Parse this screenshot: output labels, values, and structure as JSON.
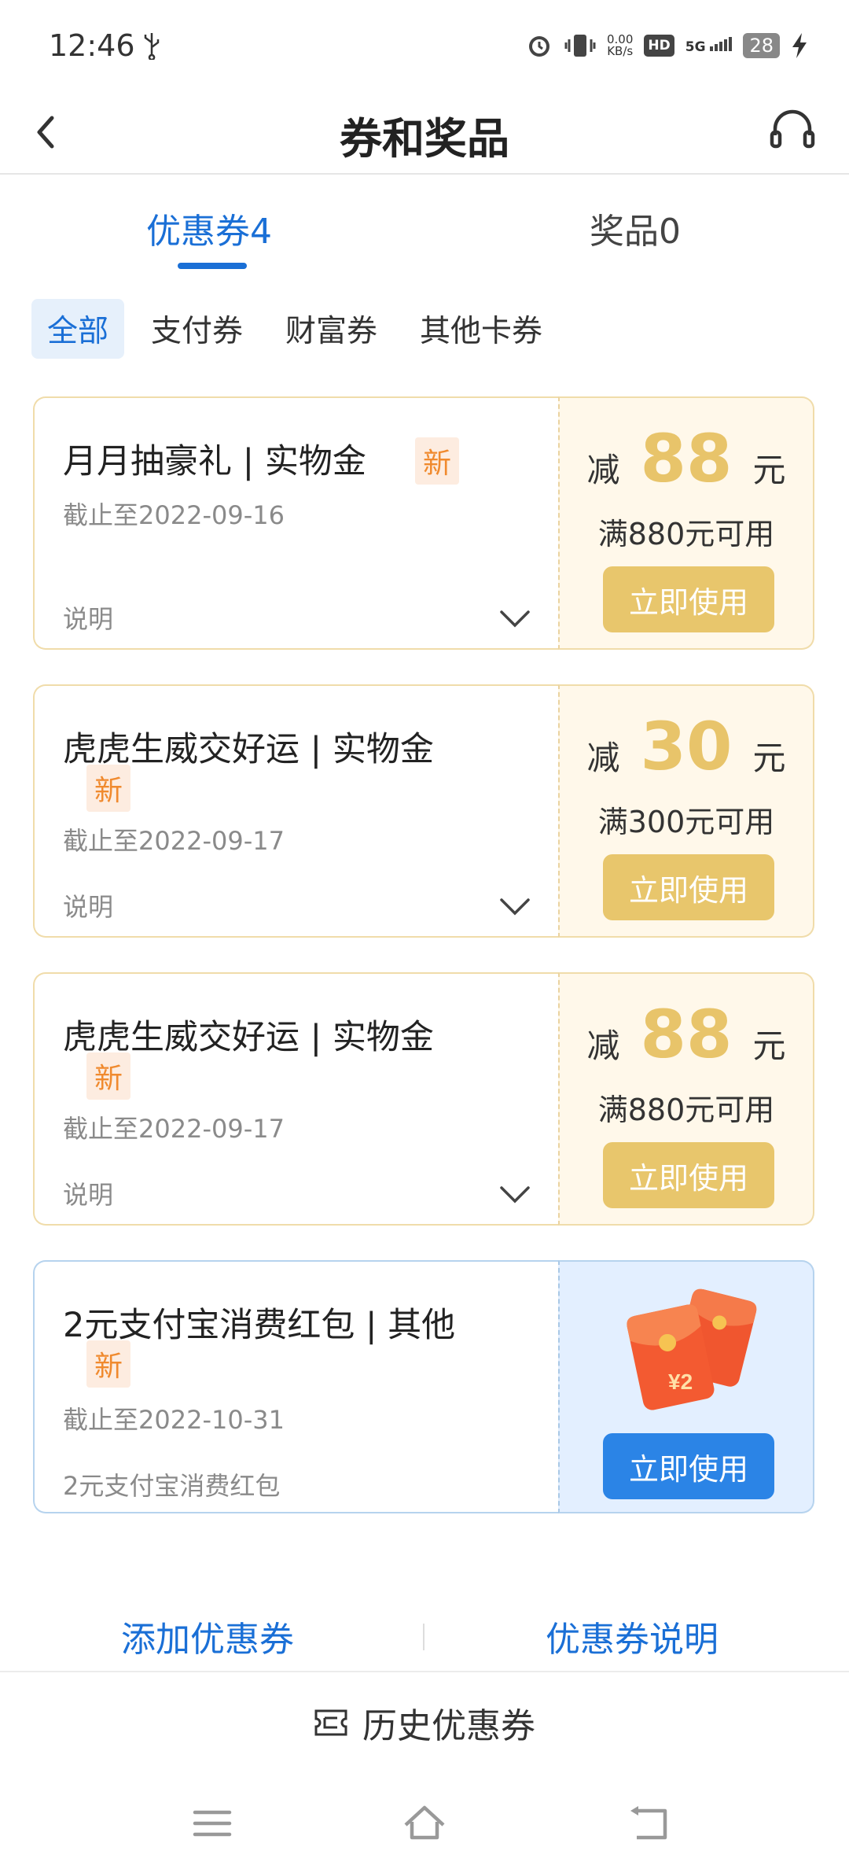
{
  "status_bar": {
    "time": "12:46",
    "net_speed_value": "0.00",
    "net_speed_unit": "KB/s",
    "hd": "HD",
    "network": "5G",
    "battery": "28"
  },
  "header": {
    "title": "券和奖品"
  },
  "tabs": [
    {
      "label": "优惠券4",
      "active": true
    },
    {
      "label": "奖品0",
      "active": false
    }
  ],
  "filters": [
    {
      "label": "全部",
      "active": true
    },
    {
      "label": "支付券",
      "active": false
    },
    {
      "label": "财富券",
      "active": false
    },
    {
      "label": "其他卡券",
      "active": false
    }
  ],
  "coupons": [
    {
      "title": "月月抽豪礼 | 实物金",
      "badge": "新",
      "expiry": "截止至2022-09-16",
      "desc": "说明",
      "prefix": "减",
      "amount": "88",
      "unit": "元",
      "condition": "满880元可用",
      "button": "立即使用"
    },
    {
      "title": "虎虎生威交好运 | 实物金",
      "badge": "新",
      "expiry": "截止至2022-09-17",
      "desc": "说明",
      "prefix": "减",
      "amount": "30",
      "unit": "元",
      "condition": "满300元可用",
      "button": "立即使用"
    },
    {
      "title": "虎虎生威交好运 | 实物金",
      "badge": "新",
      "expiry": "截止至2022-09-17",
      "desc": "说明",
      "prefix": "减",
      "amount": "88",
      "unit": "元",
      "condition": "满880元可用",
      "button": "立即使用"
    },
    {
      "title": "2元支付宝消费红包 | 其他",
      "badge": "新",
      "expiry": "截止至2022-10-31",
      "desc": "2元支付宝消费红包",
      "envelope_label": "¥2",
      "button": "立即使用"
    }
  ],
  "bottom_links": {
    "add": "添加优惠券",
    "info": "优惠券说明"
  },
  "history": {
    "label": "历史优惠券"
  },
  "colors": {
    "primary_blue": "#1a6fd6",
    "gold": "#e8c46a",
    "gold_button": "#e8c66c",
    "new_badge": "#f08a2e",
    "blue_button": "#2b84e6"
  }
}
